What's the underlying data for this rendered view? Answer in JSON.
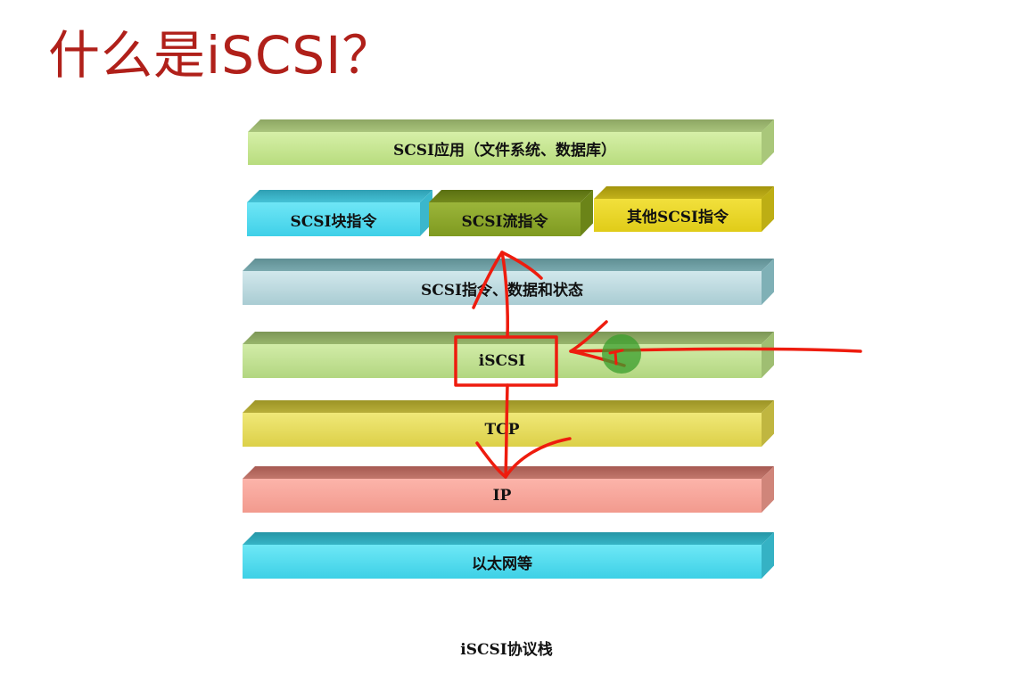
{
  "slide": {
    "title": "什么是iSCSI？",
    "caption": "iSCSI协议栈"
  },
  "layers": {
    "app": "SCSI应用（文件系统、数据库）",
    "block": "SCSI块指令",
    "stream": "SCSI流指令",
    "other": "其他SCSI指令",
    "commands": "SCSI指令、数据和状态",
    "iscsi": "iSCSI",
    "tcp": "TCP",
    "ip": "IP",
    "ethernet": "以太网等"
  },
  "colors": {
    "title": "#b0201a",
    "annotation": "#ee1c0e"
  }
}
